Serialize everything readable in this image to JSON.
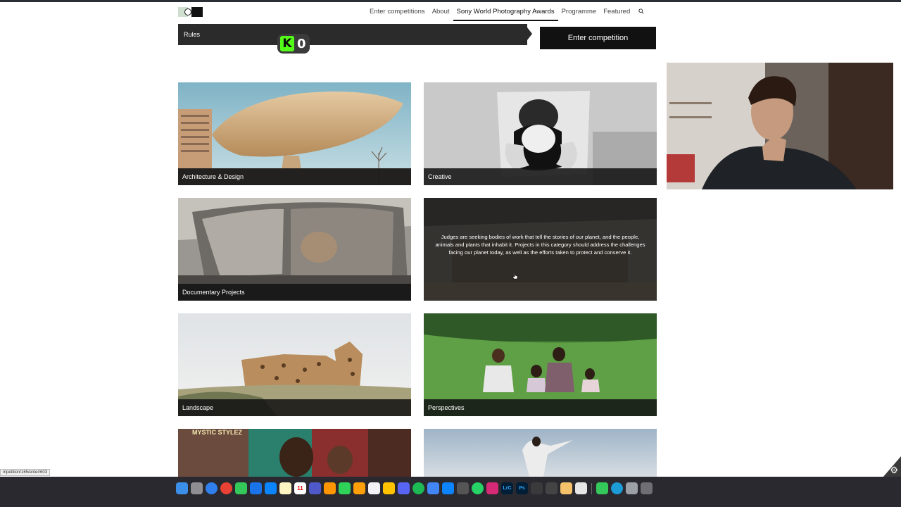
{
  "header": {
    "nav": [
      {
        "label": "Enter competitions",
        "active": false
      },
      {
        "label": "About",
        "active": false
      },
      {
        "label": "Sony World Photography Awards",
        "active": true
      },
      {
        "label": "Programme",
        "active": false
      },
      {
        "label": "Featured",
        "active": false
      }
    ]
  },
  "rules_bar": {
    "label": "Rules"
  },
  "enter_button": {
    "label": "Enter competition"
  },
  "kick_badge": {
    "letter": "K",
    "count": "0"
  },
  "categories": [
    {
      "label": "Architecture & Design"
    },
    {
      "label": "Creative"
    },
    {
      "label": "Documentary Projects"
    },
    {
      "label": "Judges are seeking bodies of work that tell the stories of our planet, and the people, animals and plants that inhabit it. Projects in this category should address the challenges facing our planet today, as well as the efforts taken to protect and conserve it."
    },
    {
      "label": "Landscape"
    },
    {
      "label": "Perspectives"
    }
  ],
  "partial_tile_text": "MYSTIC STYLEZ",
  "status_url": "mpetition/165/enter/603",
  "dock": {
    "calendar_day": "11",
    "lr_label": "LrC",
    "ps_label": "Ps"
  },
  "colors": {
    "accent": "#111111",
    "kick_green": "#53fc18",
    "dock_bg": "#2b2930"
  }
}
